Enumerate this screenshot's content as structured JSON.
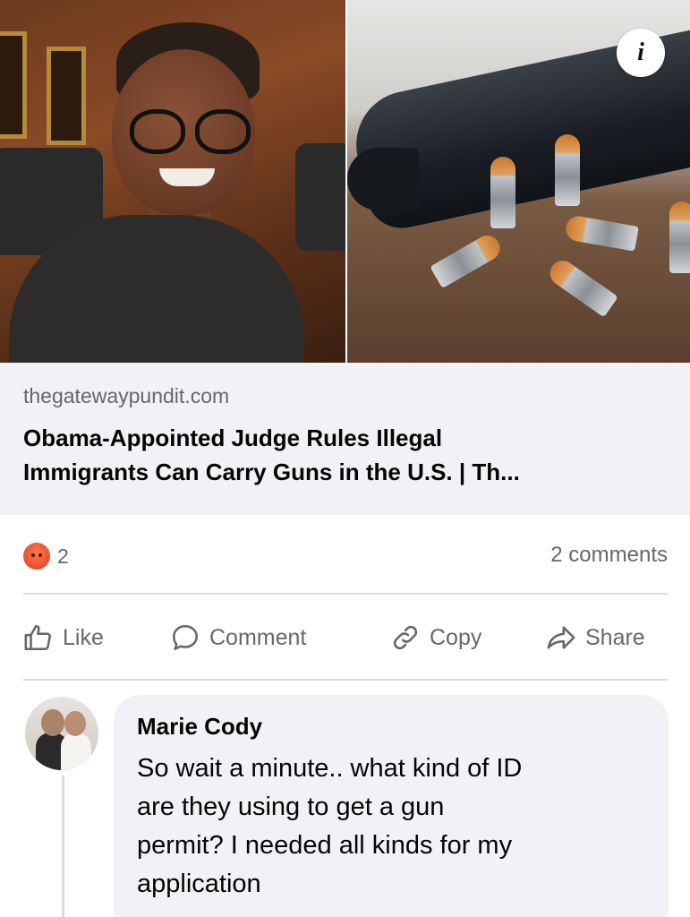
{
  "link_preview": {
    "info_icon_text": "i",
    "domain": "thegatewaypundit.com",
    "headline_line1": "Obama-Appointed Judge Rules Illegal",
    "headline_line2": "Immigrants Can Carry Guns in the U.S. | Th..."
  },
  "stats": {
    "reaction_icon": "angry-emoji-icon",
    "reaction_count": "2",
    "comments_label": "2 comments"
  },
  "actions": {
    "like": "Like",
    "comment": "Comment",
    "copy": "Copy",
    "share": "Share"
  },
  "comment": {
    "author": "Marie Cody",
    "lines": [
      "So wait a minute.. what kind of ID",
      "are they using to get a gun",
      "permit? I needed all kinds for my",
      "application"
    ]
  },
  "colors": {
    "meta_background": "#f0f2f5",
    "secondary_text": "#65676b",
    "primary_text": "#050505",
    "reaction_red": "#e8462a"
  }
}
